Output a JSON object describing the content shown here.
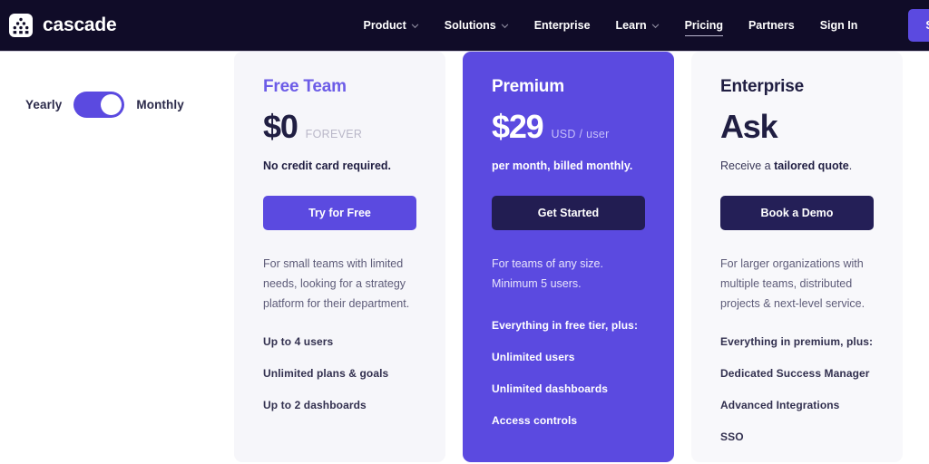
{
  "header": {
    "brand": {
      "name": "cascade",
      "logo_icon": "cascade-pyramid-logo"
    },
    "nav": [
      {
        "label": "Product",
        "has_caret": true,
        "active": false
      },
      {
        "label": "Solutions",
        "has_caret": true,
        "active": false
      },
      {
        "label": "Enterprise",
        "has_caret": false,
        "active": false
      },
      {
        "label": "Learn",
        "has_caret": true,
        "active": false
      },
      {
        "label": "Pricing",
        "has_caret": false,
        "active": true
      },
      {
        "label": "Partners",
        "has_caret": false,
        "active": false
      },
      {
        "label": "Sign In",
        "has_caret": false,
        "active": false
      }
    ],
    "cta_label": "Sign up for free",
    "background_color": "#100c28",
    "accent_color": "#5b4ae0"
  },
  "billing_toggle": {
    "left_label": "Yearly",
    "right_label": "Monthly",
    "selected": "Monthly",
    "track_color": "#5b4ae0",
    "knob_color": "#ffffff"
  },
  "plans": [
    {
      "id": "free-team",
      "name": "Free Team",
      "price_amount": "$0",
      "price_unit": "FOREVER",
      "price_note": "No credit card required.",
      "cta_label": "Try for Free",
      "description": "For small teams with limited needs, looking for a strategy platform for their department.",
      "features": [
        "Up to 4 users",
        "Unlimited plans & goals",
        "Up to 2 dashboards"
      ],
      "highlight": false,
      "background_color": "#f6f6fa",
      "title_color": "#6c5ce7"
    },
    {
      "id": "premium",
      "name": "Premium",
      "price_amount": "$29",
      "price_unit": "USD / user",
      "price_note": "per month, billed monthly.",
      "cta_label": "Get Started",
      "description_line1": "For teams of any size.",
      "description_line2": "Minimum 5 users.",
      "features": [
        "Everything in free tier, plus:",
        "Unlimited users",
        "Unlimited dashboards",
        "Access controls"
      ],
      "highlight": true,
      "background_color": "#5b4ae0",
      "title_color": "#ffffff"
    },
    {
      "id": "enterprise",
      "name": "Enterprise",
      "price_amount": "Ask",
      "price_unit": "",
      "price_note_prefix": "Receive a ",
      "price_note_bold": "tailored quote",
      "price_note_suffix": ".",
      "cta_label": "Book a Demo",
      "description": "For larger organizations with multiple teams, distributed projects & next-level service.",
      "features": [
        "Everything in premium, plus:",
        "Dedicated Success Manager",
        "Advanced Integrations",
        "SSO"
      ],
      "highlight": false,
      "background_color": "#f8f8fb",
      "title_color": "#201e42"
    }
  ]
}
